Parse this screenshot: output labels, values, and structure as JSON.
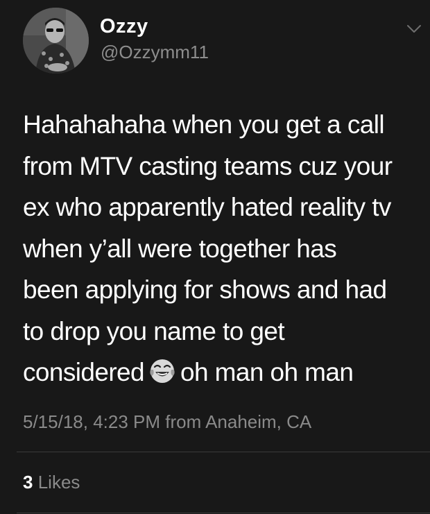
{
  "user": {
    "display_name": "Ozzy",
    "handle": "@Ozzymm11"
  },
  "tweet": {
    "lines": [
      "Hahahahaha when you get a call",
      "from MTV casting teams cuz your",
      "ex who apparently hated reality tv",
      "when y’all were together  has",
      "been applying for shows and had",
      "to drop you name to get"
    ],
    "last_line_before_emoji": "considered",
    "last_line_after_emoji": "oh man oh man",
    "emoji": "face-with-tears-of-joy-icon"
  },
  "meta": {
    "timestamp": "5/15/18, 4:23 PM",
    "from_label": "from",
    "location": "Anaheim, CA"
  },
  "stats": {
    "likes_count": "3",
    "likes_label": "Likes"
  },
  "colors": {
    "background": "#181818",
    "text": "#ffffff",
    "secondary_text": "#8a8a8a",
    "divider": "#3a3a3a"
  }
}
